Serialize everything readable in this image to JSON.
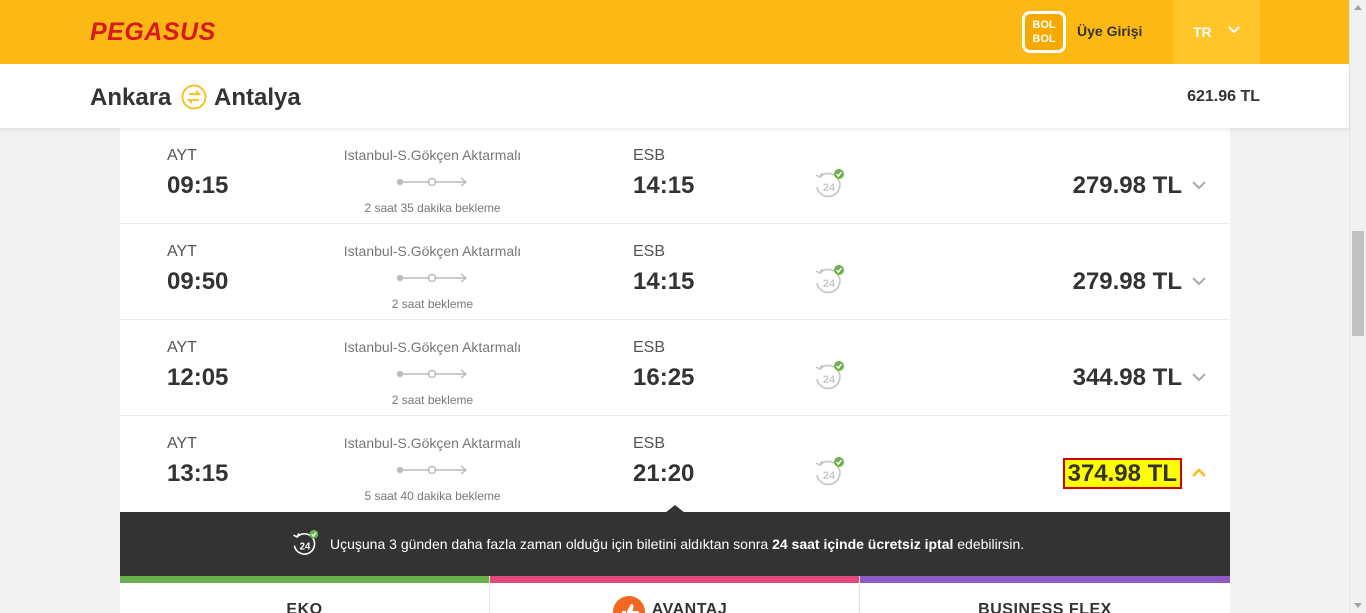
{
  "header": {
    "logo": "PEGASUS",
    "bolbol": "BOL BOL",
    "login": "Üye Girişi",
    "language": "TR",
    "logo_color": "#d71921",
    "bar_color": "#fdb913"
  },
  "route": {
    "from": "Ankara",
    "to": "Antalya",
    "total": "621.96 TL"
  },
  "flights": [
    {
      "dep_code": "AYT",
      "dep_time": "09:15",
      "via": "Istanbul-S.Gökçen Aktarmalı",
      "wait": "2 saat 35 dakika bekleme",
      "arr_code": "ESB",
      "arr_time": "14:15",
      "price": "279.98 TL"
    },
    {
      "dep_code": "AYT",
      "dep_time": "09:50",
      "via": "Istanbul-S.Gökçen Aktarmalı",
      "wait": "2 saat bekleme",
      "arr_code": "ESB",
      "arr_time": "14:15",
      "price": "279.98 TL"
    },
    {
      "dep_code": "AYT",
      "dep_time": "12:05",
      "via": "Istanbul-S.Gökçen Aktarmalı",
      "wait": "2 saat bekleme",
      "arr_code": "ESB",
      "arr_time": "16:25",
      "price": "344.98 TL"
    },
    {
      "dep_code": "AYT",
      "dep_time": "13:15",
      "via": "Istanbul-S.Gökçen Aktarmalı",
      "wait": "5 saat 40 dakika bekleme",
      "arr_code": "ESB",
      "arr_time": "21:20",
      "price": "374.98 TL",
      "selected": true
    }
  ],
  "info": {
    "text_before": "Uçuşuna 3 günden daha fazla zaman olduğu için biletini aldıktan sonra ",
    "text_bold": "24 saat içinde ücretsiz iptal",
    "text_after": " edebilirsin."
  },
  "fares": [
    {
      "name": "EKO",
      "color": "#6ab04c"
    },
    {
      "name": "AVANTAJ",
      "color": "#e2497b"
    },
    {
      "name": "BUSINESS FLEX",
      "color": "#8e5ac4"
    }
  ],
  "icons": {
    "cancel": "24h-free-cancel-icon",
    "expand": "chevron-down-icon",
    "collapse": "chevron-up-icon",
    "swap": "swap-arrows-icon"
  }
}
